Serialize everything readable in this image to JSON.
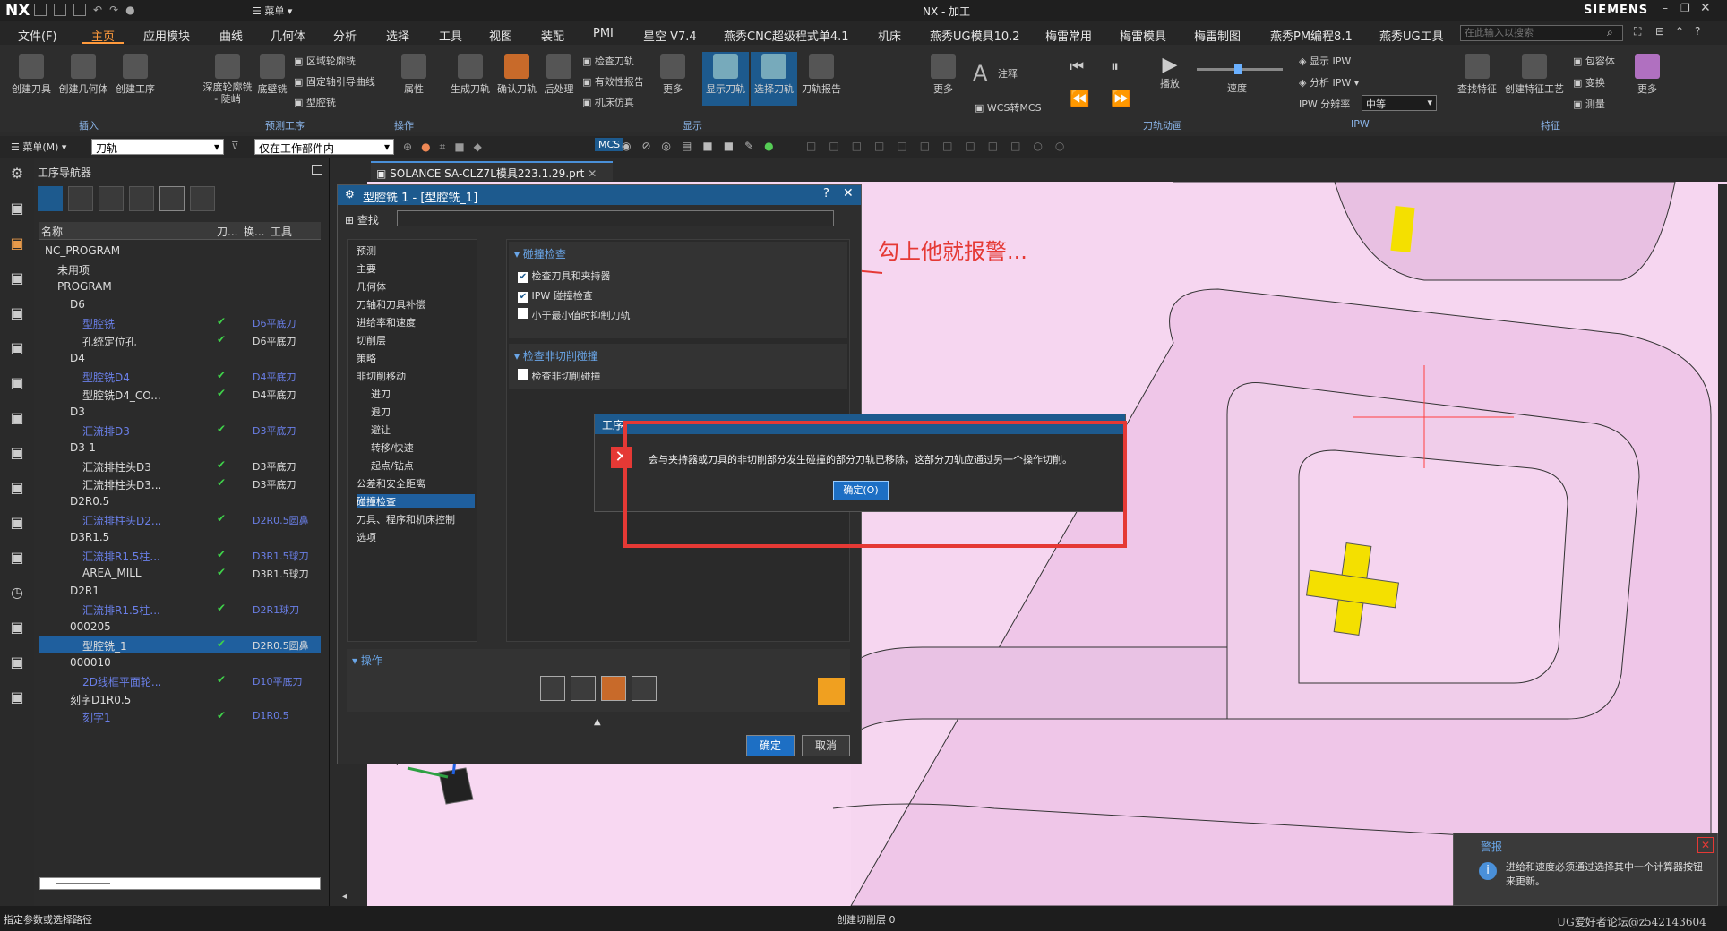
{
  "app": {
    "logo": "NX",
    "title": "NX - 加工",
    "brand": "SIEMENS",
    "menu_label": "菜单",
    "search_placeholder": "在此输入以搜索"
  },
  "menubar": {
    "items": [
      "文件(F)",
      "主页",
      "应用模块",
      "曲线",
      "几何体",
      "分析",
      "选择",
      "工具",
      "视图",
      "装配",
      "PMI",
      "星空 V7.4",
      "燕秀CNC超级程式单4.1",
      "机床",
      "燕秀UG模具10.2",
      "梅雷常用",
      "梅雷模具",
      "梅雷制图",
      "燕秀PM编程8.1",
      "燕秀UG工具"
    ]
  },
  "ribbon": {
    "insert_buttons": [
      "创建刀具",
      "创建几何体",
      "创建工序"
    ],
    "insert_group": "插入",
    "predict_buttons": [
      "深度轮廓铣 - 陡峭",
      "底壁铣"
    ],
    "predict_small": [
      "区域轮廓铣",
      "固定轴引导曲线",
      "型腔铣"
    ],
    "predict_group": "预测工序",
    "ops_buttons": [
      "属性"
    ],
    "ops_group": "操作",
    "display_buttons": [
      "生成刀轨",
      "确认刀轨",
      "后处理"
    ],
    "display_small": [
      "检查刀轨",
      "有效性报告",
      "机床仿真"
    ],
    "more": "更多",
    "show_buttons": [
      "显示刀轨",
      "选择刀轨",
      "刀轨报告"
    ],
    "display_group": "显示",
    "annot": "注释",
    "wcs": "WCS转MCS",
    "anim_buttons": [
      "播放",
      "速度"
    ],
    "anim_group": "刀轨动画",
    "ipw_show": "显示 IPW",
    "ipw_analyze": "分析 IPW",
    "ipw_res_label": "IPW 分辨率",
    "ipw_res_value": "中等",
    "ipw_group": "IPW",
    "feat_buttons": [
      "查找特征",
      "创建特征工艺"
    ],
    "feat_small": [
      "包容体",
      "变换",
      "测量"
    ],
    "feat_group": "特征"
  },
  "toolbar2": {
    "menu": "菜单(M)",
    "filter": "刀轨",
    "scope": "仅在工作部件内"
  },
  "navigator": {
    "title": "工序导航器",
    "columns": [
      "名称",
      "刀...",
      "换...",
      "工具"
    ],
    "rows": [
      {
        "level": 0,
        "name": "NC_PROGRAM",
        "ok": false,
        "tool": "",
        "link": false
      },
      {
        "level": 1,
        "name": "未用项",
        "ok": false,
        "tool": "",
        "link": false
      },
      {
        "level": 1,
        "name": "PROGRAM",
        "ok": false,
        "tool": "",
        "link": false
      },
      {
        "level": 2,
        "name": "D6",
        "ok": false,
        "tool": "",
        "link": false
      },
      {
        "level": 3,
        "name": "型腔铣",
        "ok": true,
        "tool": "D6平底刀",
        "link": true
      },
      {
        "level": 3,
        "name": "孔统定位孔",
        "ok": true,
        "tool": "D6平底刀",
        "link": false
      },
      {
        "level": 2,
        "name": "D4",
        "ok": false,
        "tool": "",
        "link": false
      },
      {
        "level": 3,
        "name": "型腔铣D4",
        "ok": true,
        "tool": "D4平底刀",
        "link": true
      },
      {
        "level": 3,
        "name": "型腔铣D4_CO...",
        "ok": true,
        "tool": "D4平底刀",
        "link": false
      },
      {
        "level": 2,
        "name": "D3",
        "ok": false,
        "tool": "",
        "link": false
      },
      {
        "level": 3,
        "name": "汇流排D3",
        "ok": true,
        "tool": "D3平底刀",
        "link": true
      },
      {
        "level": 2,
        "name": "D3-1",
        "ok": false,
        "tool": "",
        "link": false
      },
      {
        "level": 3,
        "name": "汇流排柱头D3",
        "ok": true,
        "tool": "D3平底刀",
        "link": false
      },
      {
        "level": 3,
        "name": "汇流排柱头D3...",
        "ok": true,
        "tool": "D3平底刀",
        "link": false
      },
      {
        "level": 2,
        "name": "D2R0.5",
        "ok": false,
        "tool": "",
        "link": false
      },
      {
        "level": 3,
        "name": "汇流排柱头D2...",
        "ok": true,
        "tool": "D2R0.5圆鼻",
        "link": true
      },
      {
        "level": 2,
        "name": "D3R1.5",
        "ok": false,
        "tool": "",
        "link": false
      },
      {
        "level": 3,
        "name": "汇流排R1.5柱...",
        "ok": true,
        "tool": "D3R1.5球刀",
        "link": true
      },
      {
        "level": 3,
        "name": "AREA_MILL",
        "ok": true,
        "tool": "D3R1.5球刀",
        "link": false
      },
      {
        "level": 2,
        "name": "D2R1",
        "ok": false,
        "tool": "",
        "link": false
      },
      {
        "level": 3,
        "name": "汇流排R1.5柱...",
        "ok": true,
        "tool": "D2R1球刀",
        "link": true
      },
      {
        "level": 2,
        "name": "000205",
        "ok": false,
        "tool": "",
        "link": false
      },
      {
        "level": 3,
        "name": "型腔铣_1",
        "ok": true,
        "tool": "D2R0.5圆鼻",
        "link": false,
        "selected": true
      },
      {
        "level": 2,
        "name": "000010",
        "ok": false,
        "tool": "",
        "link": false
      },
      {
        "level": 3,
        "name": "2D线框平面轮...",
        "ok": true,
        "tool": "D10平底刀",
        "link": true
      },
      {
        "level": 2,
        "name": "刻字D1R0.5",
        "ok": false,
        "tool": "",
        "link": false
      },
      {
        "level": 3,
        "name": "刻字1",
        "ok": true,
        "tool": "D1R0.5",
        "link": true
      }
    ]
  },
  "doc_tab": "SOLANCE SA-CLZ7L模具223.1.29.prt",
  "dialog": {
    "title": "型腔铣 1 - [型腔铣_1]",
    "find_label": "查找",
    "tree": [
      "预测",
      "主要",
      "几何体",
      "刀轴和刀具补偿",
      "进给率和速度",
      "切削层",
      "策略",
      "非切削移动",
      "进刀",
      "退刀",
      "避让",
      "转移/快速",
      "起点/钻点",
      "公差和安全距离",
      "碰撞检查",
      "刀具、程序和机床控制",
      "选项"
    ],
    "sec1_title": "碰撞检查",
    "opt1": "检查刀具和夹持器",
    "opt2": "IPW 碰撞检查",
    "opt3": "小于最小值时抑制刀轨",
    "sec2_title": "检查非切削碰撞",
    "opt4": "检查非切削碰撞",
    "ops_title": "操作",
    "ok": "确定",
    "cancel": "取消"
  },
  "alert": {
    "title": "工序",
    "message": "会与夹持器或刀具的非切削部分发生碰撞的部分刀轨已移除，这部分刀轨应通过另一个操作切削。",
    "ok": "确定(O)"
  },
  "annotation": "勾上他就报警...",
  "warning": {
    "title": "警报",
    "message": "进给和速度必须通过选择其中一个计算器按钮来更新。"
  },
  "status": {
    "left": "指定参数或选择路径",
    "center": "创建切削层 0",
    "watermark": "UG爱好者论坛@z542143604"
  },
  "colors": {
    "accent": "#ff9a3c",
    "selection": "#1f5f9e",
    "viewport": "#f8d8f2",
    "alert_red": "#e53935"
  }
}
